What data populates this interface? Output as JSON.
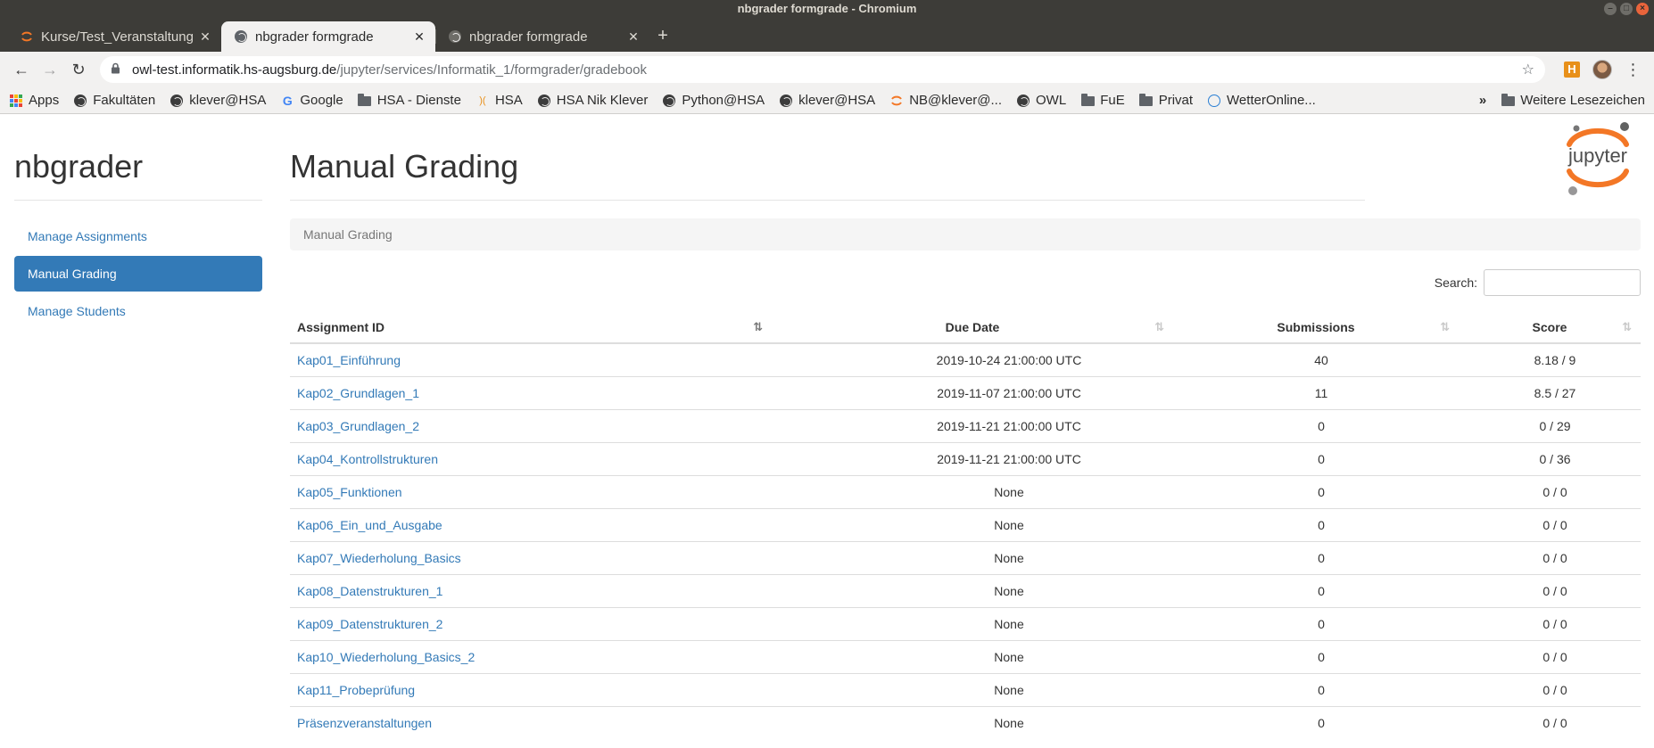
{
  "window": {
    "title": "nbgrader formgrade - Chromium"
  },
  "tabs": [
    {
      "label": "Kurse/Test_Veranstaltung",
      "icon": "jupyter-icon",
      "active": false
    },
    {
      "label": "nbgrader formgrade",
      "icon": "globe-icon",
      "active": true
    },
    {
      "label": "nbgrader formgrade",
      "icon": "globe-icon",
      "active": false
    }
  ],
  "toolbar": {
    "url_host": "owl-test.informatik.hs-augsburg.de",
    "url_path": "/jupyter/services/Informatik_1/formgrader/gradebook",
    "ext_label": "H"
  },
  "bookmarks": [
    {
      "label": "Apps",
      "icon": "apps-icon"
    },
    {
      "label": "Fakultäten",
      "icon": "globe-icon"
    },
    {
      "label": "klever@HSA",
      "icon": "globe-icon"
    },
    {
      "label": "Google",
      "icon": "google-icon"
    },
    {
      "label": "HSA - Dienste",
      "icon": "folder-icon"
    },
    {
      "label": "HSA",
      "icon": "hsa-icon"
    },
    {
      "label": "HSA Nik Klever",
      "icon": "globe-icon"
    },
    {
      "label": "Python@HSA",
      "icon": "globe-icon"
    },
    {
      "label": "klever@HSA",
      "icon": "globe-icon"
    },
    {
      "label": "NB@klever@...",
      "icon": "jupyter-icon"
    },
    {
      "label": "OWL",
      "icon": "globe-icon"
    },
    {
      "label": "FuE",
      "icon": "folder-icon"
    },
    {
      "label": "Privat",
      "icon": "folder-icon"
    },
    {
      "label": "WetterOnline...",
      "icon": "weather-icon"
    }
  ],
  "bookmarks_more": "»",
  "bookmarks_other": "Weitere Lesezeichen",
  "sidebar": {
    "brand": "nbgrader",
    "items": [
      {
        "label": "Manage Assignments",
        "active": false
      },
      {
        "label": "Manual Grading",
        "active": true
      },
      {
        "label": "Manage Students",
        "active": false
      }
    ]
  },
  "main": {
    "title": "Manual Grading",
    "logo_text": "jupyter",
    "breadcrumb": "Manual Grading",
    "search_label": "Search:",
    "search_value": "",
    "columns": [
      "Assignment ID",
      "Due Date",
      "Submissions",
      "Score"
    ],
    "rows": [
      {
        "id": "Kap01_Einführung",
        "due": "2019-10-24 21:00:00 UTC",
        "submissions": "40",
        "score": "8.18 / 9"
      },
      {
        "id": "Kap02_Grundlagen_1",
        "due": "2019-11-07 21:00:00 UTC",
        "submissions": "11",
        "score": "8.5 / 27"
      },
      {
        "id": "Kap03_Grundlagen_2",
        "due": "2019-11-21 21:00:00 UTC",
        "submissions": "0",
        "score": "0 / 29"
      },
      {
        "id": "Kap04_Kontrollstrukturen",
        "due": "2019-11-21 21:00:00 UTC",
        "submissions": "0",
        "score": "0 / 36"
      },
      {
        "id": "Kap05_Funktionen",
        "due": "None",
        "submissions": "0",
        "score": "0 / 0"
      },
      {
        "id": "Kap06_Ein_und_Ausgabe",
        "due": "None",
        "submissions": "0",
        "score": "0 / 0"
      },
      {
        "id": "Kap07_Wiederholung_Basics",
        "due": "None",
        "submissions": "0",
        "score": "0 / 0"
      },
      {
        "id": "Kap08_Datenstrukturen_1",
        "due": "None",
        "submissions": "0",
        "score": "0 / 0"
      },
      {
        "id": "Kap09_Datenstrukturen_2",
        "due": "None",
        "submissions": "0",
        "score": "0 / 0"
      },
      {
        "id": "Kap10_Wiederholung_Basics_2",
        "due": "None",
        "submissions": "0",
        "score": "0 / 0"
      },
      {
        "id": "Kap11_Probeprüfung",
        "due": "None",
        "submissions": "0",
        "score": "0 / 0"
      },
      {
        "id": "Präsenzveranstaltungen",
        "due": "None",
        "submissions": "0",
        "score": "0 / 0"
      }
    ]
  },
  "colors": {
    "link": "#337ab7",
    "accent_orange": "#f37726",
    "chrome_dark": "#3d3c38"
  }
}
